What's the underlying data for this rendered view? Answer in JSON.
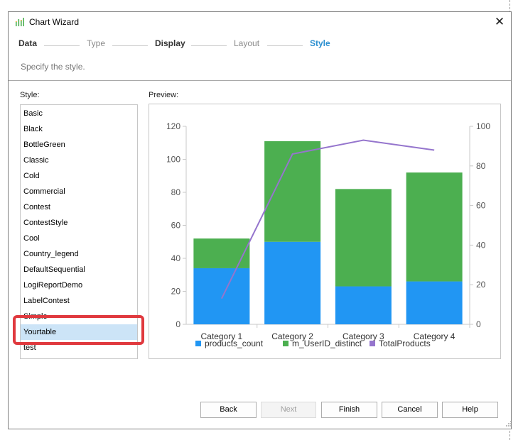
{
  "window": {
    "title": "Chart Wizard",
    "icon": "bar-chart-icon",
    "close_glyph": "✕"
  },
  "wizard": {
    "steps": [
      {
        "label": "Data",
        "state": "done"
      },
      {
        "label": "Type",
        "state": "todo"
      },
      {
        "label": "Display",
        "state": "done"
      },
      {
        "label": "Layout",
        "state": "todo"
      },
      {
        "label": "Style",
        "state": "current"
      }
    ],
    "description": "Specify the style."
  },
  "style_panel": {
    "label": "Style:",
    "selected": "Yourtable",
    "items": [
      "Basic",
      "Black",
      "BottleGreen",
      "Classic",
      "Cold",
      "Commercial",
      "Contest",
      "ContestStyle",
      "Cool",
      "Country_legend",
      "DefaultSequential",
      "LogiReportDemo",
      "LabelContest",
      "Simple",
      "Yourtable",
      "test"
    ]
  },
  "preview": {
    "label": "Preview:",
    "chart_data": {
      "type": "bar",
      "stacked": true,
      "categories": [
        "Category 1",
        "Category 2",
        "Category 3",
        "Category 4"
      ],
      "series": [
        {
          "name": "products_count",
          "type": "bar",
          "axis": "left",
          "color": "#2196f3",
          "values": [
            34,
            50,
            23,
            26
          ]
        },
        {
          "name": "m_UserID_distinct",
          "type": "bar",
          "axis": "left",
          "color": "#4caf50",
          "values": [
            18,
            61,
            59,
            66
          ]
        },
        {
          "name": "TotalProducts",
          "type": "line",
          "axis": "right",
          "color": "#9575cd",
          "values": [
            13,
            86,
            93,
            88
          ]
        }
      ],
      "y_left": {
        "min": 0,
        "max": 120,
        "ticks": [
          "0",
          "20",
          "40",
          "60",
          "80",
          "100",
          "120"
        ]
      },
      "y_right": {
        "min": 0,
        "max": 100,
        "ticks": [
          "0",
          "20",
          "40",
          "60",
          "80",
          "100"
        ]
      },
      "grid": false,
      "legend_position": "bottom"
    }
  },
  "buttons": {
    "back": "Back",
    "next": "Next",
    "finish": "Finish",
    "cancel": "Cancel",
    "help": "Help"
  }
}
